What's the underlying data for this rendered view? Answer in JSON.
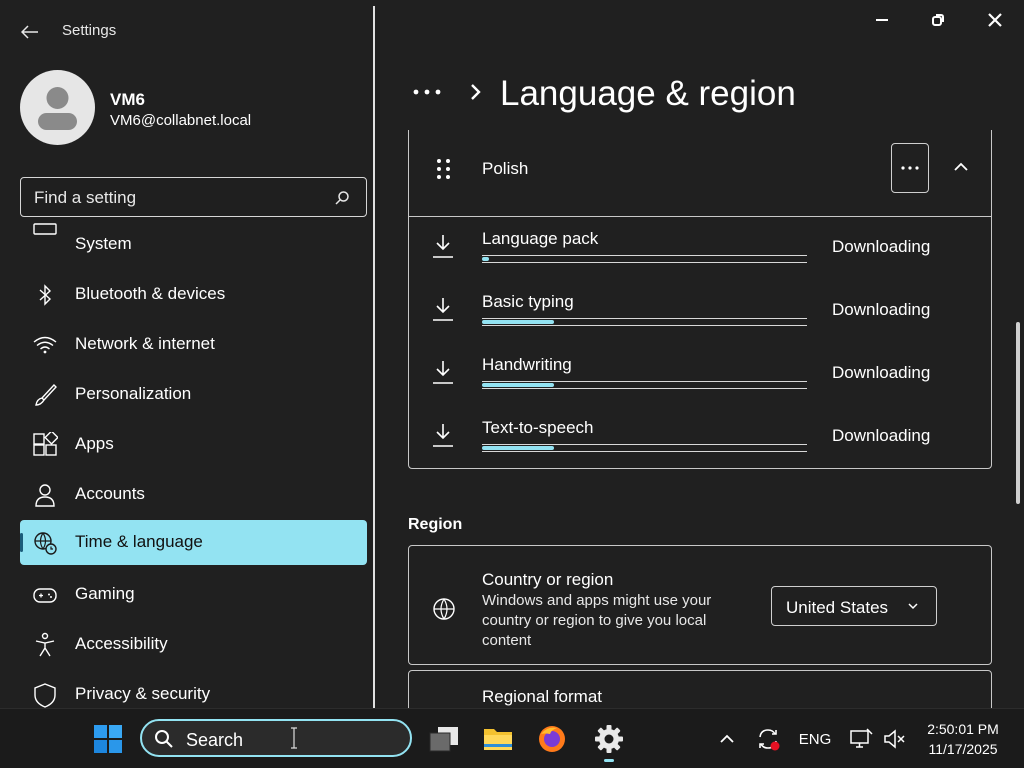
{
  "window": {
    "app_title": "Settings",
    "controls": [
      "minimize-icon",
      "restore-icon",
      "close-icon"
    ]
  },
  "profile": {
    "name": "VM6",
    "email": "VM6@collabnet.local"
  },
  "search": {
    "placeholder": "Find a setting"
  },
  "sidebar": {
    "items": [
      {
        "label": "System",
        "icon": "monitor-icon"
      },
      {
        "label": "Bluetooth & devices",
        "icon": "bluetooth-icon"
      },
      {
        "label": "Network & internet",
        "icon": "wifi-icon"
      },
      {
        "label": "Personalization",
        "icon": "brush-icon"
      },
      {
        "label": "Apps",
        "icon": "apps-icon"
      },
      {
        "label": "Accounts",
        "icon": "person-icon"
      },
      {
        "label": "Time & language",
        "icon": "globe-clock-icon",
        "active": true
      },
      {
        "label": "Gaming",
        "icon": "gamepad-icon"
      },
      {
        "label": "Accessibility",
        "icon": "accessibility-icon"
      },
      {
        "label": "Privacy & security",
        "icon": "shield-icon"
      }
    ]
  },
  "header": {
    "breadcrumb_more": "...",
    "title": "Language & region"
  },
  "language_card": {
    "language": "Polish",
    "features": [
      {
        "name": "Language pack",
        "status": "Downloading",
        "progress": 0.02
      },
      {
        "name": "Basic typing",
        "status": "Downloading",
        "progress": 0.22
      },
      {
        "name": "Handwriting",
        "status": "Downloading",
        "progress": 0.22
      },
      {
        "name": "Text-to-speech",
        "status": "Downloading",
        "progress": 0.22
      }
    ]
  },
  "region": {
    "section_title": "Region",
    "country": {
      "title": "Country or region",
      "description": "Windows and apps might use your country or region to give you local content",
      "selected": "United States"
    },
    "format_title": "Regional format"
  },
  "taskbar": {
    "search_label": "Search",
    "language": "ENG",
    "time": "2:50:01 PM",
    "date": "11/17/2025"
  },
  "colors": {
    "accent": "#93e3f2",
    "background": "#202020",
    "taskbar": "#1b1b1b"
  }
}
